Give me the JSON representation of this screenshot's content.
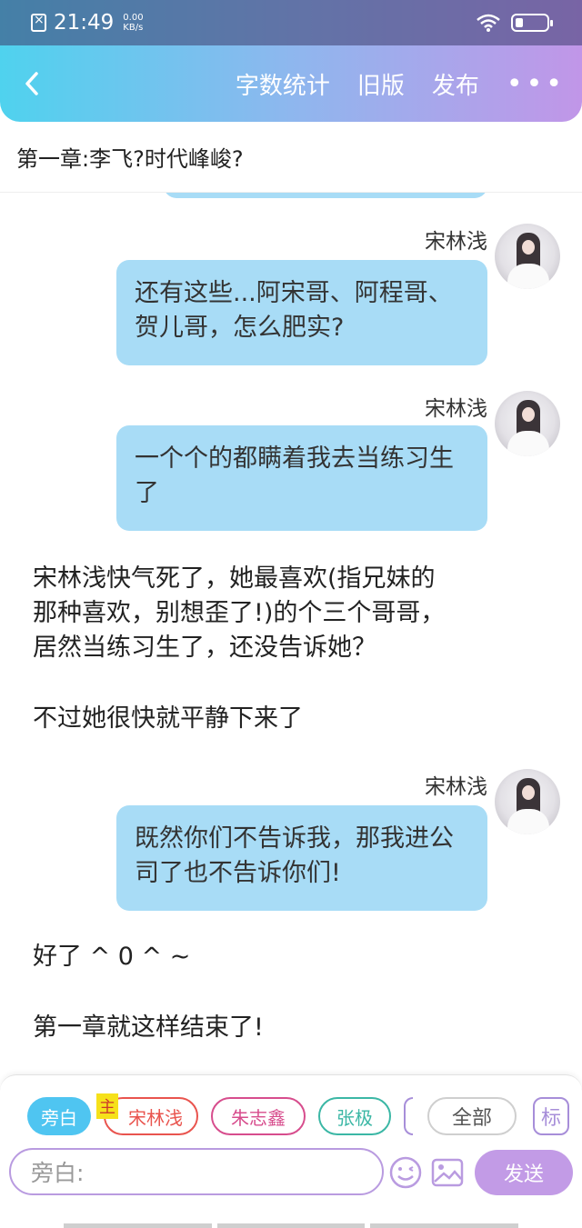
{
  "status_bar": {
    "time": "21:49",
    "speed_value": "0.00",
    "speed_unit": "KB/s"
  },
  "header": {
    "back_icon": "chevron-left-icon",
    "word_count": "字数统计",
    "old_version": "旧版",
    "publish": "发布",
    "more_icon": "more-dots-icon",
    "gradient_colors": [
      "#4fd2ee",
      "#8eb7ee",
      "#c196e8"
    ]
  },
  "chapter": {
    "title": "第一章:李飞?时代峰峻?"
  },
  "messages": [
    {
      "speaker": "宋林浅",
      "text": "还有这些...阿宋哥、阿程哥、贺儿哥，怎么肥实?"
    },
    {
      "speaker": "宋林浅",
      "text": "一个个的都瞒着我去当练习生了"
    }
  ],
  "narration_1": {
    "line1": "宋林浅快气死了，她最喜欢(指兄妹的",
    "line2": "那种喜欢，别想歪了!)的个三个哥哥，",
    "line3": "居然当练习生了，还没告诉她？"
  },
  "narration_2": "不过她很快就平静下来了",
  "message_3": {
    "speaker": "宋林浅",
    "text": "既然你们不告诉我，那我进公司了也不告诉你们!"
  },
  "narration_3": "好了 ^ 0 ^ ~",
  "narration_4": "第一章就这样结束了!",
  "roles": {
    "narrator": "旁白",
    "main_tag": "主",
    "role_1": "宋林浅",
    "role_2": "朱志鑫",
    "role_3": "张极",
    "all": "全部",
    "mark": "标"
  },
  "composer": {
    "placeholder": "旁白:",
    "emoji_icon": "smiley-icon",
    "image_icon": "image-icon",
    "send": "发送"
  },
  "colors": {
    "bubble": "#a8dcf6",
    "narrator_chip": "#4fc5f1",
    "role_1": "#e9544e",
    "role_2": "#d74d8d",
    "role_3": "#3bb7a5",
    "accent": "#c29be6"
  }
}
